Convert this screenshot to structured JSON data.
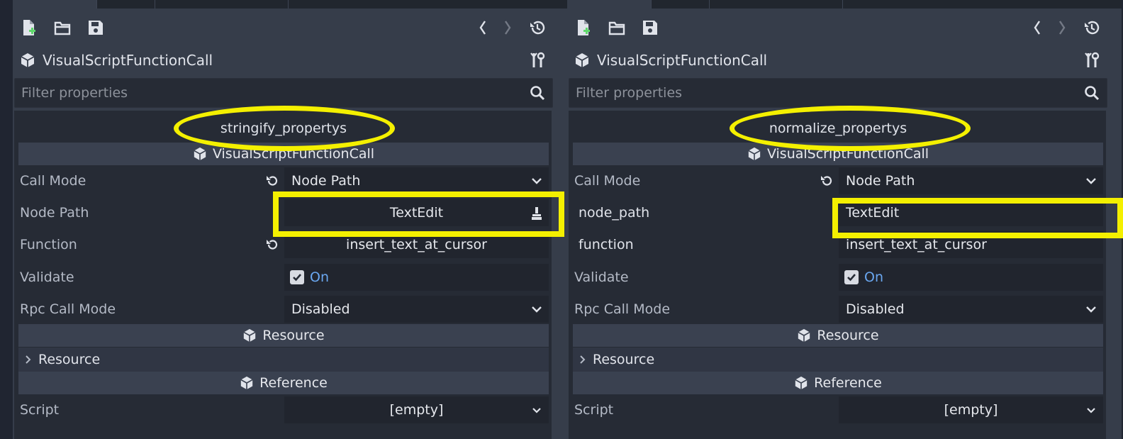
{
  "colors": {
    "highlight": "#f4f000",
    "on_text": "#6aa7f0"
  },
  "panels": [
    {
      "object_name": "VisualScriptFunctionCall",
      "filter_placeholder": "Filter properties",
      "section_title": "stringify_propertys",
      "category_main": "VisualScriptFunctionCall",
      "call_mode": {
        "label": "Call Mode",
        "value": "Node Path"
      },
      "node_path": {
        "label": "Node Path",
        "value": "TextEdit"
      },
      "function": {
        "label": "Function",
        "value": "insert_text_at_cursor"
      },
      "validate": {
        "label": "Validate",
        "value": "On"
      },
      "rpc": {
        "label": "Rpc Call Mode",
        "value": "Disabled"
      },
      "category_resource": "Resource",
      "subsection_resource": "Resource",
      "category_reference": "Reference",
      "script": {
        "label": "Script",
        "value": "[empty]"
      }
    },
    {
      "object_name": "VisualScriptFunctionCall",
      "filter_placeholder": "Filter properties",
      "section_title": "normalize_propertys",
      "category_main": "VisualScriptFunctionCall",
      "call_mode": {
        "label": "Call Mode",
        "value": "Node Path"
      },
      "node_path": {
        "label": "node_path",
        "value": "TextEdit"
      },
      "function": {
        "label": "function",
        "value": "insert_text_at_cursor"
      },
      "validate": {
        "label": "Validate",
        "value": "On"
      },
      "rpc": {
        "label": "Rpc Call Mode",
        "value": "Disabled"
      },
      "category_resource": "Resource",
      "subsection_resource": "Resource",
      "category_reference": "Reference",
      "script": {
        "label": "Script",
        "value": "[empty]"
      }
    }
  ]
}
